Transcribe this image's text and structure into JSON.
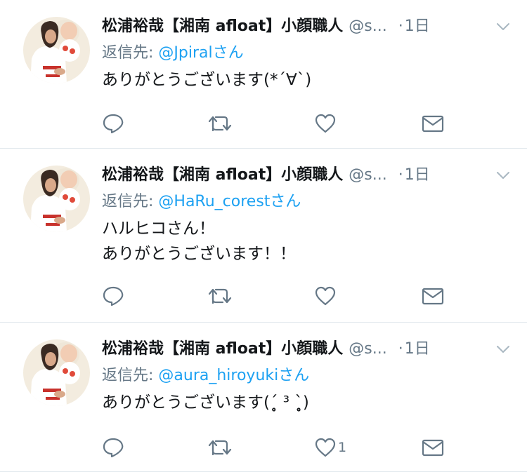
{
  "tweets": [
    {
      "display_name": "松浦裕哉【湘南 afloat】小顔職人",
      "handle": "@s...",
      "separator": "·",
      "time": "1日",
      "reply_prefix": "返信先: ",
      "reply_mention": "@Jpiralさん",
      "text": "ありがとうございます(*´∀`)",
      "like_count": ""
    },
    {
      "display_name": "松浦裕哉【湘南 afloat】小顔職人",
      "handle": "@s...",
      "separator": "·",
      "time": "1日",
      "reply_prefix": "返信先: ",
      "reply_mention": "@HaRu_corestさん",
      "text": "ハルヒコさん！\nありがとうございます！！",
      "like_count": ""
    },
    {
      "display_name": "松浦裕哉【湘南 afloat】小顔職人",
      "handle": "@s...",
      "separator": "·",
      "time": "1日",
      "reply_prefix": "返信先: ",
      "reply_mention": "@aura_hiroyukiさん",
      "text": "ありがとうございます(ˊ̥̥̥̥̥ ³ ˋ̥̥̥̥̥)",
      "like_count": "1"
    }
  ],
  "icons": {
    "reply": "reply-icon",
    "retweet": "retweet-icon",
    "like": "heart-icon",
    "dm": "envelope-icon",
    "caret": "chevron-down-icon",
    "avatar": "profile-photo"
  },
  "colors": {
    "name": "#14171a",
    "secondary": "#657786",
    "link": "#1da1f2",
    "divider": "#e1e8ed"
  }
}
